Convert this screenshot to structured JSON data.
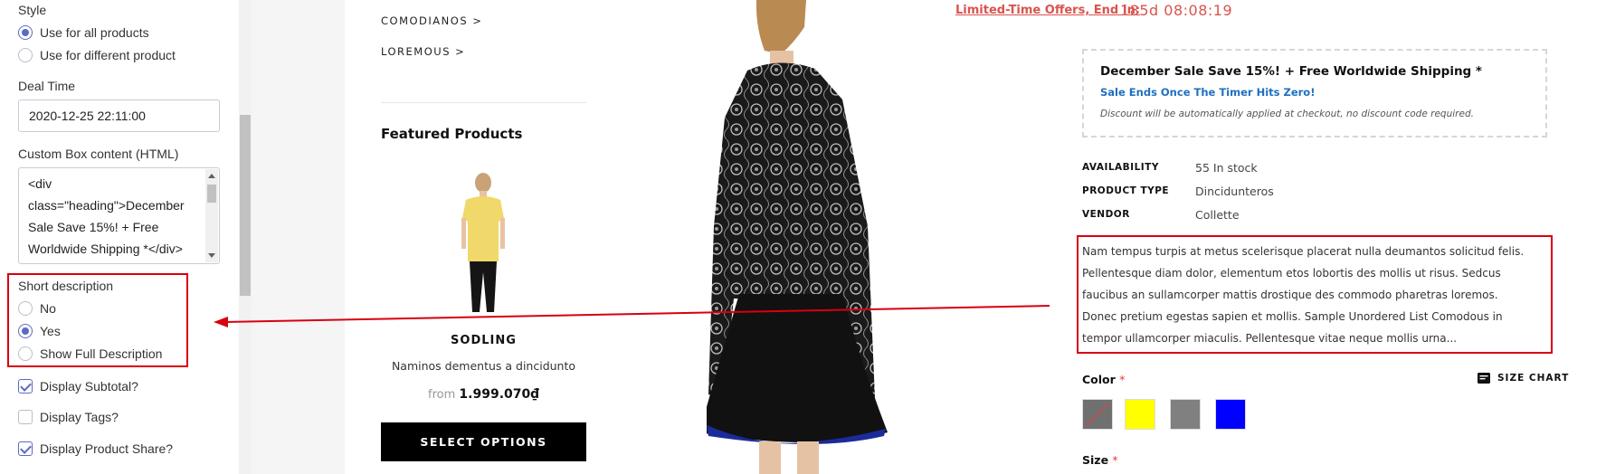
{
  "settings": {
    "style_label": "Style",
    "style_options": [
      "Use for all products",
      "Use for different product"
    ],
    "style_selected": 0,
    "deal_time_label": "Deal Time",
    "deal_time_value": "2020-12-25 22:11:00",
    "custom_box_label": "Custom Box content (HTML)",
    "custom_box_lines": [
      "<div",
      "class=\"heading\">December",
      "Sale Save 15%! + Free",
      "Worldwide Shipping *</div>"
    ],
    "short_desc_label": "Short description",
    "short_desc_options": [
      "No",
      "Yes",
      "Show Full Description"
    ],
    "short_desc_selected": 1,
    "checkboxes": [
      {
        "label": "Display Subtotal?",
        "checked": true
      },
      {
        "label": "Display Tags?",
        "checked": false
      },
      {
        "label": "Display Product Share?",
        "checked": true
      }
    ]
  },
  "store": {
    "collections": [
      "COMODIANOS >",
      "LOREMOUS >"
    ],
    "featured_heading": "Featured Products",
    "featured_product": {
      "title": "SODLING",
      "subtitle": "Naminos dementus a dincidunto",
      "price_prefix": "from",
      "price": "1.999.070₫",
      "button": "SELECT OPTIONS"
    },
    "offer": {
      "label": "Limited-Time Offers, End In:",
      "timer": "185d 08:08:19"
    },
    "promo": {
      "heading": "December Sale Save 15%! + Free Worldwide Shipping *",
      "subheading": "Sale Ends Once The Timer Hits Zero!",
      "note": "Discount will be automatically applied at checkout, no discount code required."
    },
    "meta": [
      {
        "key": "AVAILABILITY",
        "value": "55 In stock"
      },
      {
        "key": "PRODUCT TYPE",
        "value": "Dincidunteros"
      },
      {
        "key": "VENDOR",
        "value": "Collette"
      }
    ],
    "description_lines": [
      "Nam tempus turpis at metus scelerisque placerat nulla deumantos solicitud felis.",
      "Pellentesque diam dolor, elementum etos lobortis des mollis ut risus. Sedcus",
      "faucibus an sullamcorper mattis drostique des commodo pharetras loremos.",
      "Donec pretium egestas sapien et mollis. Sample Unordered List Comodous in",
      "tempor ullamcorper miaculis. Pellentesque vitae neque mollis urna..."
    ],
    "color_label": "Color",
    "required_mark": "*",
    "size_chart_label": "SIZE CHART",
    "swatch_colors": [
      "#707070",
      "#ffff00",
      "#808080",
      "#0000ff"
    ],
    "size_label": "Size"
  },
  "colors": {
    "accent": "#5c6ac4",
    "highlight": "#d8000f",
    "offer": "#d9544f"
  }
}
